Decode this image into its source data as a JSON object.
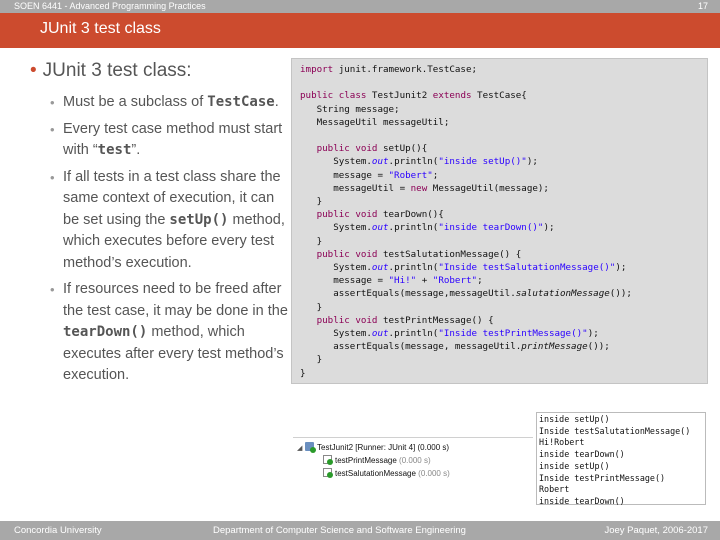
{
  "header": {
    "course": "SOEN 6441 - Advanced Programming Practices",
    "page_number": "17"
  },
  "slide_title": "JUnit 3 test class",
  "main_bullet": "JUnit 3 test class:",
  "sub_bullets": [
    {
      "pre": "Must be a subclass of ",
      "code": "TestCase",
      "post": "."
    },
    {
      "pre": "Every test case method must start with “",
      "code": "test",
      "post": "”."
    },
    {
      "pre": "If all tests in a test class share the same context of execution, it can be set using the ",
      "code": "setUp()",
      "post": " method, which executes before every test method’s execution."
    },
    {
      "pre": "If resources need to be freed after the test case, it may be done in the ",
      "code": "tearDown()",
      "post": " method, which executes after every test method’s execution."
    }
  ],
  "code": {
    "import_kw": "import",
    "import_rest": " junit.framework.TestCase;",
    "class_kw": "public class",
    "class_name": " TestJunit2 ",
    "extends_kw": "extends",
    "extends_rest": " TestCase{",
    "field1": "   String message;",
    "field2": "   MessageUtil messageUtil;",
    "setup_kw": "   public void",
    "setup_rest": " setUp(){",
    "setup_l1a": "      System.",
    "setup_l1b": "out",
    "setup_l1c": ".println(",
    "setup_l1s": "\"inside setUp()\"",
    "setup_l1d": ");",
    "setup_l2a": "      message = ",
    "setup_l2s": "\"Robert\"",
    "setup_l2b": ";",
    "setup_l3a": "      messageUtil = ",
    "setup_l3kw": "new",
    "setup_l3b": " MessageUtil(message);",
    "close1": "   }",
    "teardown_kw": "   public void",
    "teardown_rest": " tearDown(){",
    "td_l1a": "      System.",
    "td_l1b": "out",
    "td_l1c": ".println(",
    "td_l1s": "\"inside tearDown()\"",
    "td_l1d": ");",
    "close2": "   }",
    "sal_kw": "   public void",
    "sal_rest": " testSalutationMessage() {",
    "sal_l1a": "      System.",
    "sal_l1b": "out",
    "sal_l1c": ".println(",
    "sal_l1s": "\"Inside testSalutationMessage()\"",
    "sal_l1d": ");",
    "sal_l2a": "      message = ",
    "sal_l2s1": "\"Hi!\"",
    "sal_l2b": " + ",
    "sal_l2s2": "\"Robert\"",
    "sal_l2c": ";",
    "sal_l3a": "      assertEquals(message,messageUtil.",
    "sal_l3i": "salutationMessage",
    "sal_l3b": "());",
    "close3": "   }",
    "print_kw": "   public void",
    "print_rest": " testPrintMessage() {",
    "pr_l1a": "      System.",
    "pr_l1b": "out",
    "pr_l1c": ".println(",
    "pr_l1s": "\"Inside testPrintMessage()\"",
    "pr_l1d": ");",
    "pr_l2a": "      assertEquals(message, messageUtil.",
    "pr_l2i": "printMessage",
    "pr_l2b": "());",
    "close4": "   }",
    "close5": "}"
  },
  "junit_tree": {
    "suite": "TestJunit2 [Runner: JUnit 4] (0.000 s)",
    "tests": [
      {
        "name": "testPrintMessage",
        "time": "(0.000 s)"
      },
      {
        "name": "testSalutationMessage",
        "time": "(0.000 s)"
      }
    ]
  },
  "console_lines": [
    "inside setUp()",
    "Inside testSalutationMessage()",
    "Hi!Robert",
    "inside tearDown()",
    "inside setUp()",
    "Inside testPrintMessage()",
    "Robert",
    "inside tearDown()"
  ],
  "footer": {
    "left": "Concordia University",
    "center": "Department of Computer Science and Software Engineering",
    "right": "Joey Paquet, 2006-2017"
  },
  "colors": {
    "title_bar": "#cc4b2e",
    "gray_bar": "#a8a8a8",
    "keyword": "#8b0055",
    "string": "#2a00ff"
  }
}
